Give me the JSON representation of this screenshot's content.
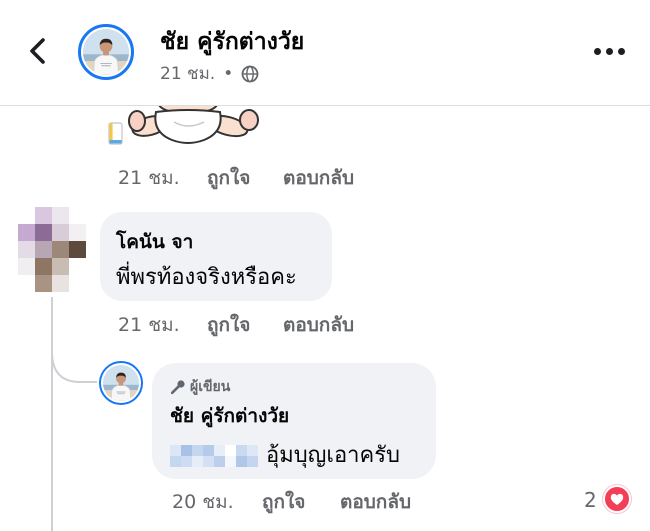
{
  "header": {
    "name": "ชัย คู่รักต่างวัย",
    "time": "21 ชม.",
    "separator": "•",
    "icons": {
      "back": "chevron-left-icon",
      "audience": "globe-icon",
      "more": "more-dots-icon"
    }
  },
  "sticker_comment": {
    "sticker_icon": "baby-diaper-sticker",
    "time": "21 ชม.",
    "like_label": "ถูกใจ",
    "reply_label": "ตอบกลับ"
  },
  "comments": [
    {
      "author": "โคนัน จา",
      "text": "พี่พรท้องจริงหรือคะ",
      "time": "21 ชม.",
      "like_label": "ถูกใจ",
      "reply_label": "ตอบกลับ",
      "replies": [
        {
          "badge": "ผู้เขียน",
          "badge_icon": "microphone-icon",
          "author": "ชัย คู่รักต่างวัย",
          "text": "อุ้มบุญเอาครับ",
          "time": "20 ชม.",
          "like_label": "ถูกใจ",
          "reply_label": "ตอบกลับ",
          "reaction": {
            "icon": "love-heart-icon",
            "count": "2"
          }
        }
      ]
    }
  ],
  "colors": {
    "accent": "#1877f2",
    "bubble": "#f0f2f5",
    "secondary_text": "#65676b",
    "love": "#f33e58",
    "thread_line": "#ced0d4"
  }
}
